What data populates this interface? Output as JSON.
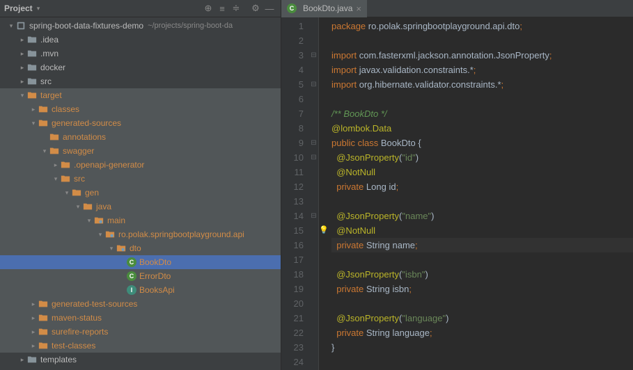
{
  "sidebar": {
    "title": "Project",
    "project_name": "spring-boot-data-fixtures-demo",
    "project_path": "~/projects/spring-boot-da",
    "tree": [
      {
        "indent": 0,
        "exp": "▾",
        "iconClass": "i-module",
        "icon": "▢",
        "label": "spring-boot-data-fixtures-demo",
        "labelClass": "",
        "extra": "~/projects/spring-boot-da",
        "hl": false,
        "sel": false,
        "name": "project-root"
      },
      {
        "indent": 1,
        "exp": "▸",
        "iconClass": "i-folder",
        "icon": "folder",
        "label": ".idea",
        "labelClass": "",
        "hl": false,
        "sel": false,
        "name": "folder-idea"
      },
      {
        "indent": 1,
        "exp": "▸",
        "iconClass": "i-folder",
        "icon": "folder",
        "label": ".mvn",
        "labelClass": "",
        "hl": false,
        "sel": false,
        "name": "folder-mvn"
      },
      {
        "indent": 1,
        "exp": "▸",
        "iconClass": "i-folder",
        "icon": "folder",
        "label": "docker",
        "labelClass": "",
        "hl": false,
        "sel": false,
        "name": "folder-docker"
      },
      {
        "indent": 1,
        "exp": "▸",
        "iconClass": "i-folder",
        "icon": "folder",
        "label": "src",
        "labelClass": "",
        "hl": false,
        "sel": false,
        "name": "folder-src"
      },
      {
        "indent": 1,
        "exp": "▾",
        "iconClass": "i-folder-o",
        "icon": "folder",
        "label": "target",
        "labelClass": "orange",
        "hl": true,
        "sel": false,
        "name": "folder-target"
      },
      {
        "indent": 2,
        "exp": "▸",
        "iconClass": "i-folder-o",
        "icon": "folder",
        "label": "classes",
        "labelClass": "orange",
        "hl": true,
        "sel": false,
        "name": "folder-classes"
      },
      {
        "indent": 2,
        "exp": "▾",
        "iconClass": "i-folder-o",
        "icon": "folder",
        "label": "generated-sources",
        "labelClass": "orange",
        "hl": true,
        "sel": false,
        "name": "folder-generated-sources"
      },
      {
        "indent": 3,
        "exp": "",
        "iconClass": "i-folder-o",
        "icon": "folder",
        "label": "annotations",
        "labelClass": "orange",
        "hl": true,
        "sel": false,
        "name": "folder-annotations"
      },
      {
        "indent": 3,
        "exp": "▾",
        "iconClass": "i-folder-o",
        "icon": "folder",
        "label": "swagger",
        "labelClass": "orange",
        "hl": true,
        "sel": false,
        "name": "folder-swagger"
      },
      {
        "indent": 4,
        "exp": "▸",
        "iconClass": "i-folder-o",
        "icon": "folder",
        "label": ".openapi-generator",
        "labelClass": "orange",
        "hl": true,
        "sel": false,
        "name": "folder-openapi-generator"
      },
      {
        "indent": 4,
        "exp": "▾",
        "iconClass": "i-folder-o",
        "icon": "folder",
        "label": "src",
        "labelClass": "orange",
        "hl": true,
        "sel": false,
        "name": "folder-swagger-src"
      },
      {
        "indent": 5,
        "exp": "▾",
        "iconClass": "i-folder-o",
        "icon": "folder",
        "label": "gen",
        "labelClass": "orange",
        "hl": true,
        "sel": false,
        "name": "folder-gen"
      },
      {
        "indent": 6,
        "exp": "▾",
        "iconClass": "i-folder-o",
        "icon": "folder",
        "label": "java",
        "labelClass": "orange",
        "hl": true,
        "sel": false,
        "name": "folder-java"
      },
      {
        "indent": 7,
        "exp": "▾",
        "iconClass": "i-folder-o",
        "icon": "folder-pkg",
        "label": "main",
        "labelClass": "orange",
        "hl": true,
        "sel": false,
        "name": "folder-main"
      },
      {
        "indent": 8,
        "exp": "▾",
        "iconClass": "i-folder-o",
        "icon": "folder-pkg",
        "label": "ro.polak.springbootplayground.api",
        "labelClass": "orange",
        "hl": true,
        "sel": false,
        "name": "package-api"
      },
      {
        "indent": 9,
        "exp": "▾",
        "iconClass": "i-folder-o",
        "icon": "folder-pkg",
        "label": "dto",
        "labelClass": "orange",
        "hl": true,
        "sel": false,
        "name": "package-dto"
      },
      {
        "indent": 10,
        "exp": "",
        "iconClass": "i-class",
        "icon": "C",
        "label": "BookDto",
        "labelClass": "orange",
        "hl": false,
        "sel": true,
        "name": "class-bookdto"
      },
      {
        "indent": 10,
        "exp": "",
        "iconClass": "i-class",
        "icon": "C",
        "label": "ErrorDto",
        "labelClass": "orange",
        "hl": true,
        "sel": false,
        "name": "class-errordto"
      },
      {
        "indent": 10,
        "exp": "",
        "iconClass": "i-interface",
        "icon": "I",
        "label": "BooksApi",
        "labelClass": "orange",
        "hl": true,
        "sel": false,
        "name": "interface-booksapi"
      },
      {
        "indent": 2,
        "exp": "▸",
        "iconClass": "i-folder-o",
        "icon": "folder",
        "label": "generated-test-sources",
        "labelClass": "orange",
        "hl": true,
        "sel": false,
        "name": "folder-generated-test-sources"
      },
      {
        "indent": 2,
        "exp": "▸",
        "iconClass": "i-folder-o",
        "icon": "folder",
        "label": "maven-status",
        "labelClass": "orange",
        "hl": true,
        "sel": false,
        "name": "folder-maven-status"
      },
      {
        "indent": 2,
        "exp": "▸",
        "iconClass": "i-folder-o",
        "icon": "folder",
        "label": "surefire-reports",
        "labelClass": "orange",
        "hl": true,
        "sel": false,
        "name": "folder-surefire-reports"
      },
      {
        "indent": 2,
        "exp": "▸",
        "iconClass": "i-folder-o",
        "icon": "folder",
        "label": "test-classes",
        "labelClass": "orange",
        "hl": true,
        "sel": false,
        "name": "folder-test-classes"
      },
      {
        "indent": 1,
        "exp": "▸",
        "iconClass": "i-folder",
        "icon": "folder",
        "label": "templates",
        "labelClass": "",
        "hl": false,
        "sel": false,
        "name": "folder-templates"
      }
    ]
  },
  "tab": {
    "label": "BookDto.java"
  },
  "code": {
    "lines": [
      {
        "n": 1,
        "fold": "",
        "bulb": "",
        "html": "<span class='kw'>package</span> <span class='pkg'>ro.polak.springbootplayground.api.dto</span><span class='kw'>;</span>"
      },
      {
        "n": 2,
        "fold": "",
        "bulb": "",
        "html": ""
      },
      {
        "n": 3,
        "fold": "⊟",
        "bulb": "",
        "html": "<span class='kw'>import</span> <span class='pkg'>com.fasterxml.jackson.annotation.</span><span class='cls'>JsonProperty</span><span class='kw'>;</span>"
      },
      {
        "n": 4,
        "fold": "",
        "bulb": "",
        "html": "<span class='kw'>import</span> <span class='pkg'>javax.validation.constraints.*</span><span class='kw'>;</span>"
      },
      {
        "n": 5,
        "fold": "⊟",
        "bulb": "",
        "html": "<span class='kw'>import</span> <span class='pkg'>org.hibernate.validator.constraints.*</span><span class='kw'>;</span>"
      },
      {
        "n": 6,
        "fold": "",
        "bulb": "",
        "html": ""
      },
      {
        "n": 7,
        "fold": "",
        "bulb": "",
        "html": "<span class='cmt'>/** BookDto */</span>"
      },
      {
        "n": 8,
        "fold": "",
        "bulb": "",
        "html": "<span class='ann'>@lombok.Data</span>"
      },
      {
        "n": 9,
        "fold": "⊟",
        "bulb": "",
        "html": "<span class='kw'>public</span> <span class='kw'>class</span> <span class='cls'>BookDto</span> {"
      },
      {
        "n": 10,
        "fold": "⊟",
        "bulb": "",
        "html": "  <span class='ann'>@JsonProperty</span>(<span class='str'>\"id\"</span>)"
      },
      {
        "n": 11,
        "fold": "",
        "bulb": "",
        "html": "  <span class='ann'>@NotNull</span>"
      },
      {
        "n": 12,
        "fold": "",
        "bulb": "",
        "html": "  <span class='kw'>private</span> <span class='cls'>Long</span> <span class='id'>id</span><span class='kw'>;</span>"
      },
      {
        "n": 13,
        "fold": "",
        "bulb": "",
        "html": ""
      },
      {
        "n": 14,
        "fold": "⊟",
        "bulb": "",
        "html": "  <span class='ann'>@JsonProperty</span>(<span class='str'>\"name\"</span>)"
      },
      {
        "n": 15,
        "fold": "",
        "bulb": "💡",
        "html": "  <span class='ann'>@NotNull</span>"
      },
      {
        "n": 16,
        "fold": "",
        "bulb": "",
        "html": "  <span class='kw'>private</span> <span class='cls'>String</span> <span class='id'>name</span><span class='kw'>;</span>",
        "cur": true
      },
      {
        "n": 17,
        "fold": "",
        "bulb": "",
        "html": ""
      },
      {
        "n": 18,
        "fold": "",
        "bulb": "",
        "html": "  <span class='ann'>@JsonProperty</span>(<span class='str'>\"isbn\"</span>)"
      },
      {
        "n": 19,
        "fold": "",
        "bulb": "",
        "html": "  <span class='kw'>private</span> <span class='cls'>String</span> <span class='id'>isbn</span><span class='kw'>;</span>"
      },
      {
        "n": 20,
        "fold": "",
        "bulb": "",
        "html": ""
      },
      {
        "n": 21,
        "fold": "",
        "bulb": "",
        "html": "  <span class='ann'>@JsonProperty</span>(<span class='str'>\"language\"</span>)"
      },
      {
        "n": 22,
        "fold": "",
        "bulb": "",
        "html": "  <span class='kw'>private</span> <span class='cls'>String</span> <span class='id'>language</span><span class='kw'>;</span>"
      },
      {
        "n": 23,
        "fold": "",
        "bulb": "",
        "html": "}"
      },
      {
        "n": 24,
        "fold": "",
        "bulb": "",
        "html": ""
      }
    ]
  }
}
